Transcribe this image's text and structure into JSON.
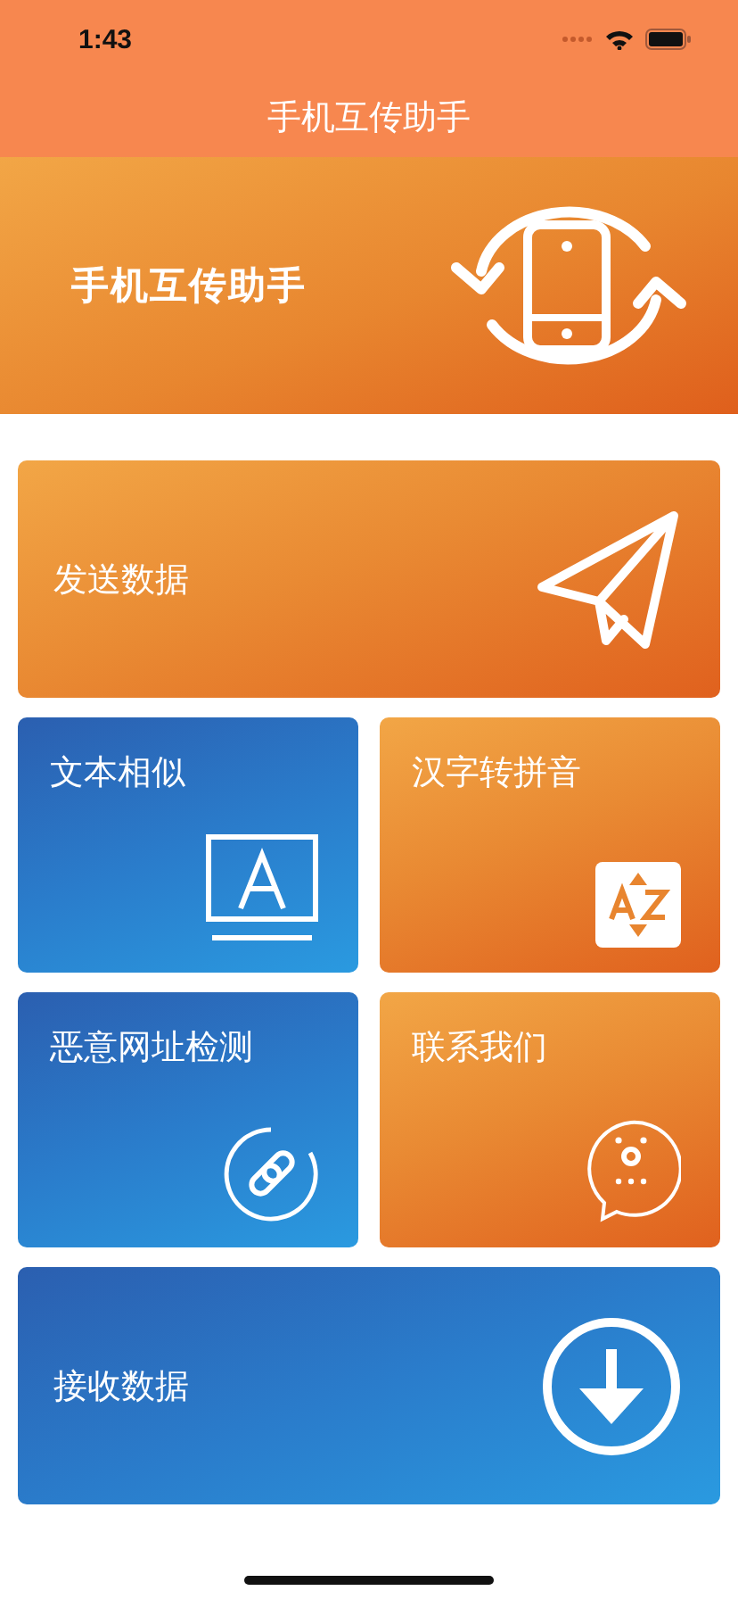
{
  "status_bar": {
    "time": "1:43"
  },
  "nav_bar": {
    "title": "手机互传助手"
  },
  "banner": {
    "title": "手机互传助手"
  },
  "rows": [
    {
      "cards": [
        {
          "label": "发送数据"
        }
      ]
    },
    {
      "cards": [
        {
          "label": "文本相似"
        },
        {
          "label": "汉字转拼音"
        }
      ]
    },
    {
      "cards": [
        {
          "label": "恶意网址检测"
        },
        {
          "label": "联系我们"
        }
      ]
    },
    {
      "cards": [
        {
          "label": "接收数据"
        }
      ]
    }
  ]
}
